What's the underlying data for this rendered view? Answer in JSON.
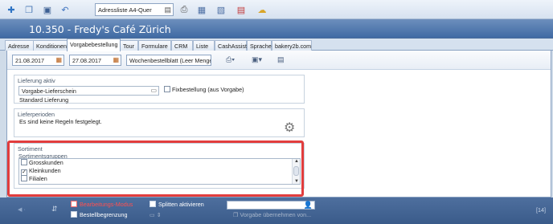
{
  "toolbar": {
    "icons": [
      "add-icon",
      "copy-icon",
      "save-icon",
      "undo-icon",
      "report-icon",
      "print-icon",
      "export-icon",
      "document-icon",
      "delete-icon",
      "comment-icon"
    ],
    "report_combo_value": "Adressliste A4-Quer"
  },
  "header": {
    "title": "10.350 - Fredy's Café Zürich"
  },
  "tabs": [
    {
      "label": "Adresse"
    },
    {
      "label": "Konditionen"
    },
    {
      "label": "Vorgabebestellung"
    },
    {
      "label": "Tour"
    },
    {
      "label": "Formulare"
    },
    {
      "label": "CRM"
    },
    {
      "label": "Liste"
    },
    {
      "label": "CashAssist"
    },
    {
      "label": "Sprache"
    },
    {
      "label": "bakery2b.com"
    }
  ],
  "active_tab": "Vorgabebestellung",
  "subtoolbar": {
    "date_from": "21.08.2017",
    "date_to": "27.08.2017",
    "week_combo": "Wochenbestellblatt (Leer Menge)"
  },
  "lieferung": {
    "title": "Lieferung aktiv",
    "field_value": "Vorgabe-Lieferschein",
    "subtext": "Standard Lieferung",
    "fix_label": "Fixbestellung (aus Vorgabe)"
  },
  "lieferperioden": {
    "title": "Lieferperioden",
    "text": "Es sind keine Regeln festgelegt."
  },
  "sortiment": {
    "title": "Sortiment",
    "subtitle": "Sortimentsgruppen",
    "items": [
      {
        "label": "Grosskunden",
        "checked": false
      },
      {
        "label": "Kleinkunden",
        "checked": true
      },
      {
        "label": "Filialen",
        "checked": false
      }
    ]
  },
  "bottombar": {
    "edit_mode": "Bearbeitungs-Modus",
    "limit": "Bestellbegrenzung",
    "split": "Splitten aktivieren",
    "apply": "Vorgabe übernehmen von...",
    "counter": "[14]"
  },
  "colors": {
    "header": "#3f6aa3",
    "highlight": "#e23d3d",
    "bottombar": "#3a5b8a"
  }
}
